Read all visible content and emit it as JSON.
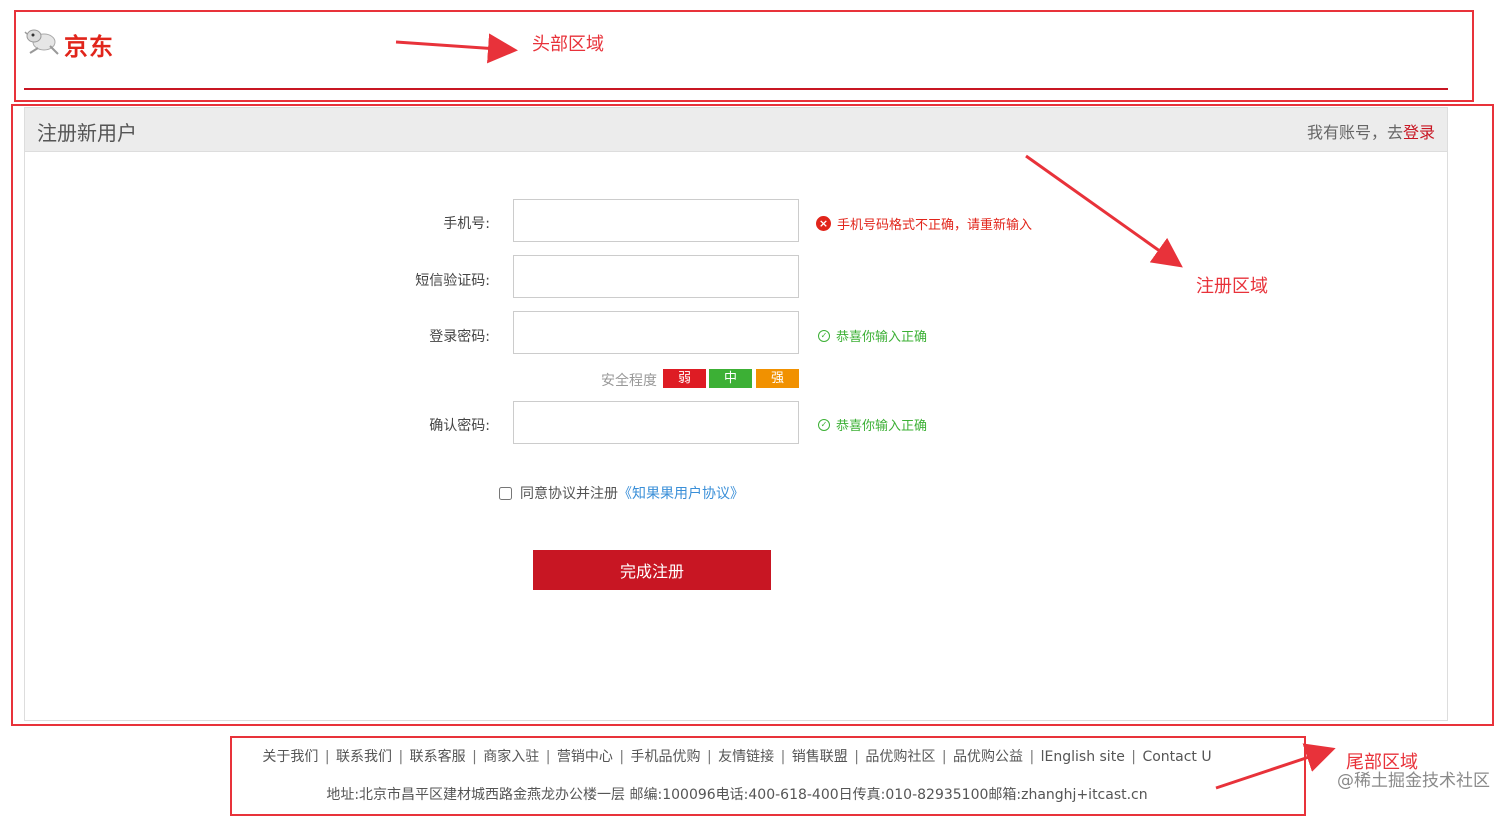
{
  "header": {
    "logo_text": "京东",
    "annotation": "头部区域"
  },
  "register": {
    "annotation": "注册区域",
    "title": "注册新用户",
    "have_account": "我有账号，去",
    "login_link": "登录",
    "fields": [
      {
        "label": "手机号:",
        "value": "",
        "message": "手机号码格式不正确，请重新输入",
        "status": "error"
      },
      {
        "label": "短信验证码:",
        "value": "",
        "message": "",
        "status": "none"
      },
      {
        "label": "登录密码:",
        "value": "",
        "message": "恭喜你输入正确",
        "status": "ok"
      },
      {
        "label": "确认密码:",
        "value": "",
        "message": "恭喜你输入正确",
        "status": "ok"
      }
    ],
    "strength": {
      "label": "安全程度",
      "levels": [
        {
          "text": "弱",
          "color": "#de1c24"
        },
        {
          "text": "中",
          "color": "#3cb035"
        },
        {
          "text": "强",
          "color": "#f19100"
        }
      ]
    },
    "agree": {
      "text": "同意协议并注册",
      "link": "《知果果用户协议》",
      "checked": false
    },
    "submit_label": "完成注册"
  },
  "footer": {
    "annotation": "尾部区域",
    "links": [
      "关于我们",
      "联系我们",
      "联系客服",
      "商家入驻",
      "营销中心",
      "手机品优购",
      "友情链接",
      "销售联盟",
      "品优购社区",
      "品优购公益",
      "lEnglish site",
      "Contact U"
    ],
    "address": "地址:北京市昌平区建材城西路金燕龙办公楼一层 邮编:100096电话:400-618-400日传真:010-82935100邮箱:zhanghj+itcast.cn"
  },
  "watermark": "@稀土掘金技术社区",
  "colors": {
    "annotation": "#e8323a",
    "brand": "#c81623",
    "error": "#e1251b",
    "success": "#3cb035",
    "link": "#3a8fd8"
  }
}
